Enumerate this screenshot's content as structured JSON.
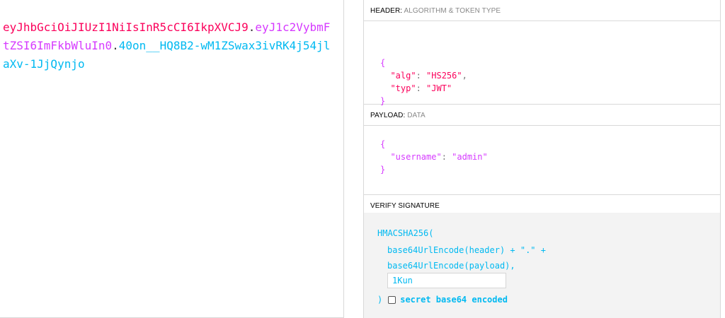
{
  "encoded": {
    "header": "eyJhbGciOiJIUzI1NiIsInR5cCI6IkpXVCJ9",
    "dot1": ".",
    "payload": "eyJ1c2VybmFtZSI6ImFkbWluIn0",
    "dot2": ".",
    "signature": "40on__HQ8B2-wM1ZSwax3ivRK4j54jlaXv-1JjQynjo"
  },
  "header_section": {
    "title": "HEADER:",
    "subtitle": "ALGORITHM & TOKEN TYPE",
    "open_brace": "{",
    "close_brace": "}",
    "alg_key": "\"alg\"",
    "alg_val": "\"HS256\"",
    "typ_key": "\"typ\"",
    "typ_val": "\"JWT\""
  },
  "payload_section": {
    "title": "PAYLOAD:",
    "subtitle": "DATA",
    "open_brace": "{",
    "close_brace": "}",
    "username_key": "\"username\"",
    "username_val": "\"admin\""
  },
  "verify_section": {
    "title": "VERIFY SIGNATURE",
    "fn": "HMACSHA256(",
    "line_header": "base64UrlEncode(header) + \".\" +",
    "line_payload": "base64UrlEncode(payload),",
    "secret_value": "1Kun",
    "close_paren": ")",
    "checkbox_label": "secret base64 encoded"
  },
  "colors": {
    "header": "#fb015b",
    "payload": "#d63aff",
    "signature": "#00b9f1"
  }
}
